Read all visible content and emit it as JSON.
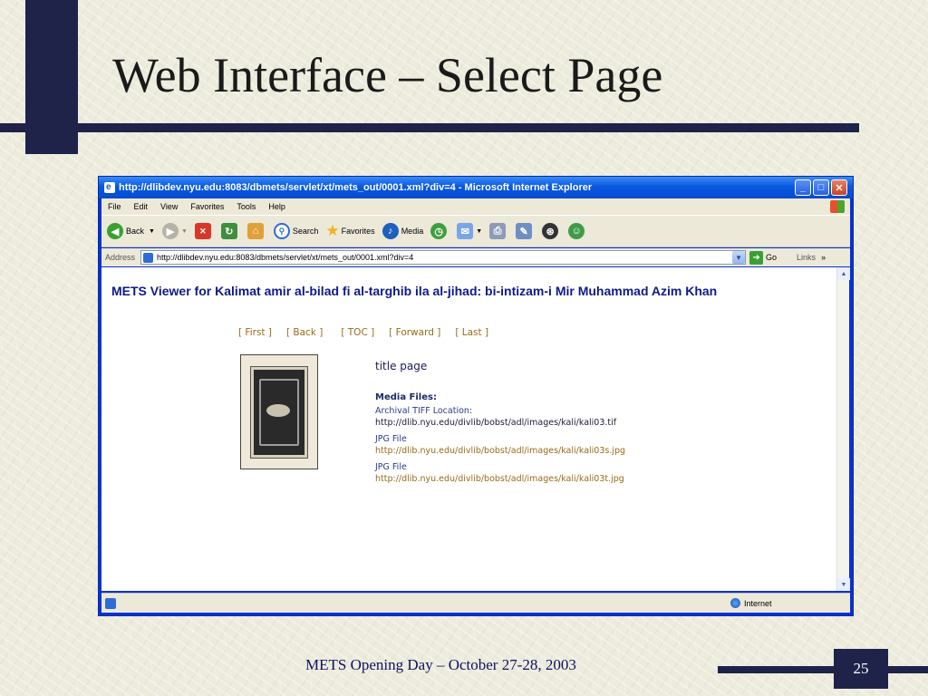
{
  "slide": {
    "title": "Web Interface – Select Page",
    "footer": "METS Opening Day – October 27-28, 2003",
    "page_number": "25"
  },
  "browser": {
    "window_title": "http://dlibdev.nyu.edu:8083/dbmets/servlet/xt/mets_out/0001.xml?div=4 - Microsoft Internet Explorer",
    "menu": [
      "File",
      "Edit",
      "View",
      "Favorites",
      "Tools",
      "Help"
    ],
    "toolbar": {
      "back": "Back",
      "search": "Search",
      "favorites": "Favorites",
      "media": "Media"
    },
    "address": {
      "label": "Address",
      "value": "http://dlibdev.nyu.edu:8083/dbmets/servlet/xt/mets_out/0001.xml?div=4",
      "go": "Go",
      "links": "Links"
    },
    "status": {
      "zone": "Internet"
    }
  },
  "page": {
    "heading": "METS Viewer for Kalimat amir al-bilad fi al-targhib ila al-jihad: bi-intizam-i Mir Muhammad Azim Khan",
    "nav": {
      "first": "[ First ]",
      "back": "[ Back ]",
      "toc": "[ TOC ]",
      "forward": "[ Forward ]",
      "last": "[ Last ]"
    },
    "page_label": "title page",
    "media_heading": "Media Files:",
    "files": [
      {
        "label": "Archival TIFF Location:",
        "url": "http://dlib.nyu.edu/divlib/bobst/adl/images/kali/kali03.tif"
      },
      {
        "label": "JPG File",
        "url": "http://dlib.nyu.edu/divlib/bobst/adl/images/kali/kali03s.jpg"
      },
      {
        "label": "JPG File",
        "url": "http://dlib.nyu.edu/divlib/bobst/adl/images/kali/kali03t.jpg"
      }
    ]
  },
  "colors": {
    "accent_navy": "#1f2349",
    "heading_blue": "#0e1a8a",
    "link_brown": "#9a6a18"
  },
  "icons": [
    "ie-icon",
    "back-arrow-icon",
    "forward-arrow-icon",
    "stop-icon",
    "refresh-icon",
    "home-icon",
    "search-icon",
    "favorites-star-icon",
    "media-icon",
    "history-icon",
    "mail-icon",
    "print-icon",
    "edit-icon",
    "messenger-icon",
    "go-arrow-icon",
    "globe-icon"
  ]
}
